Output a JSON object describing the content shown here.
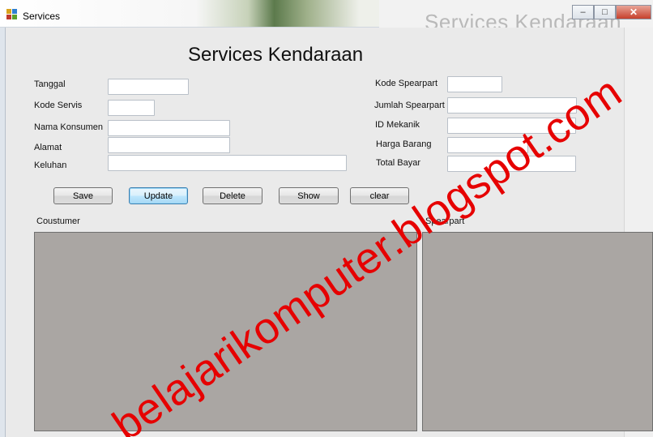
{
  "window": {
    "title": "Services",
    "background_title": "Services Kendaraan",
    "controls": {
      "minimize": "–",
      "maximize": "□",
      "close": "✕"
    }
  },
  "form": {
    "heading": "Services Kendaraan",
    "left_fields": [
      {
        "label": "Tanggal",
        "value": ""
      },
      {
        "label": "Kode Servis",
        "value": ""
      },
      {
        "label": "Nama Konsumen",
        "value": ""
      },
      {
        "label": "Alamat",
        "value": ""
      },
      {
        "label": "Keluhan",
        "value": ""
      }
    ],
    "right_fields": [
      {
        "label": "Kode Spearpart",
        "value": ""
      },
      {
        "label": "Jumlah Spearpart",
        "value": ""
      },
      {
        "label": "ID Mekanik",
        "value": ""
      },
      {
        "label": "Harga Barang",
        "value": ""
      },
      {
        "label": "Total Bayar",
        "value": ""
      }
    ],
    "buttons": {
      "save": "Save",
      "update": "Update",
      "delete": "Delete",
      "show": "Show",
      "clear": "clear"
    }
  },
  "grids": {
    "customer_label": "Coustumer",
    "sparepart_label": "Spearpart"
  },
  "watermark": "belajarikomputer.blogspot.com",
  "colors": {
    "watermark": "#e60000",
    "grid_background": "#aaa6a3",
    "window_background": "#eaeaea"
  },
  "icons": [
    "app-icon",
    "minimize-icon",
    "maximize-icon",
    "close-icon"
  ]
}
